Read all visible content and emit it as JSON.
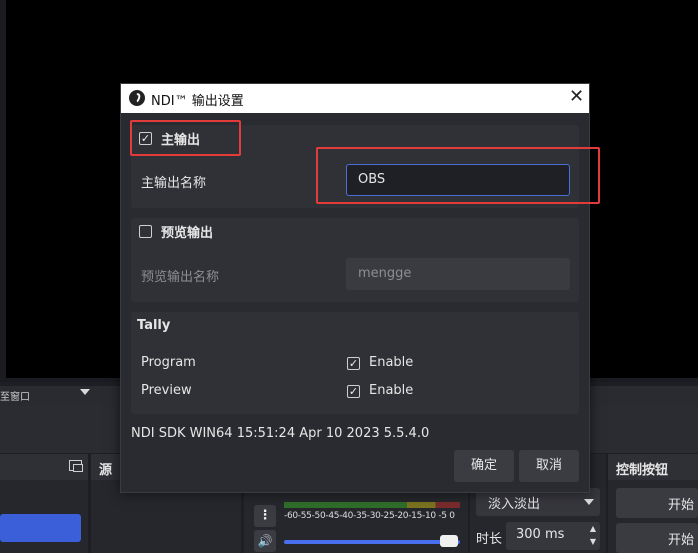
{
  "background": {
    "edge_label": "至窗口",
    "sources_title": "源",
    "mixer_ticks": "-60-55-50-45-40-35-30-25-20-15-10 -5  0",
    "transition_select": "淡入淡出",
    "duration_label": "时长",
    "duration_value": "300 ms",
    "controls_title": "控制按钮",
    "start_label_1": "开始",
    "start_label_2": "开始"
  },
  "dialog": {
    "title": "NDI™ 输出设置",
    "main_output": {
      "checkbox_label": "主输出",
      "checked": true,
      "name_label": "主输出名称",
      "name_value": "OBS"
    },
    "preview_output": {
      "checkbox_label": "预览输出",
      "checked": false,
      "name_label": "预览输出名称",
      "name_placeholder": "mengge"
    },
    "tally": {
      "title": "Tally",
      "rows": [
        {
          "label": "Program",
          "option": "Enable",
          "checked": true
        },
        {
          "label": "Preview",
          "option": "Enable",
          "checked": true
        }
      ]
    },
    "sdk_info": "NDI SDK WIN64 15:51:24 Apr 10 2023 5.5.4.0",
    "ok_label": "确定",
    "cancel_label": "取消"
  },
  "colors": {
    "accent": "#4a6fd8",
    "highlight": "#e33a3a"
  }
}
